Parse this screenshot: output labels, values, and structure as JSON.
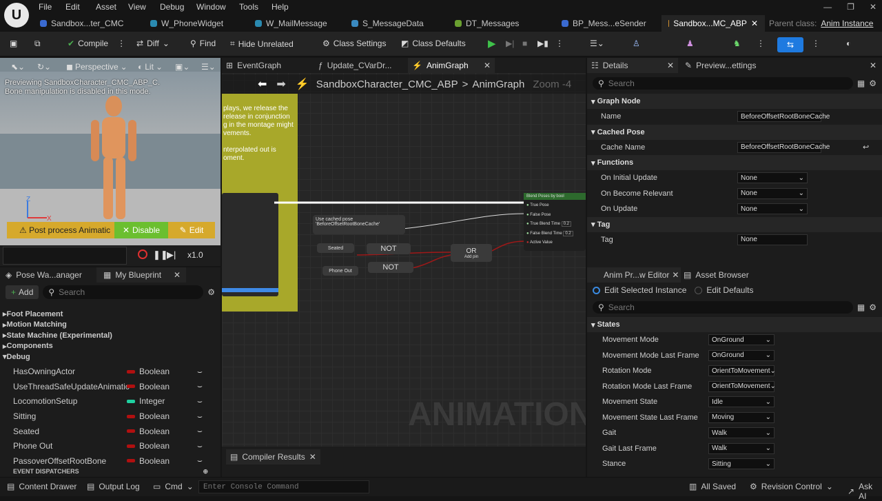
{
  "menu": [
    "File",
    "Edit",
    "Asset",
    "View",
    "Debug",
    "Window",
    "Tools",
    "Help"
  ],
  "tabs": [
    "Sandbox...ter_CMC",
    "W_PhoneWidget",
    "W_MailMessage",
    "S_MessageData",
    "DT_Messages",
    "BP_Mess...eSender",
    "Sandbox...MC_ABP"
  ],
  "parent_class_label": "Parent class:",
  "parent_class_value": "Anim Instance",
  "toolbar": {
    "compile": "Compile",
    "diff": "Diff",
    "find": "Find",
    "hide_unrelated": "Hide Unrelated",
    "class_settings": "Class Settings",
    "class_defaults": "Class Defaults"
  },
  "viewport": {
    "perspective": "Perspective",
    "lit": "Lit",
    "preview_text": "Previewing SandboxCharacter_CMC_ABP_C.",
    "disabled_text": "Bone manipulation is disabled in this mode.",
    "warning": "Post process Animatic",
    "disable": "Disable",
    "edit": "Edit",
    "speed": "x1.0",
    "axis_x": "X",
    "axis_z": "Z"
  },
  "graph": {
    "tab_event": "EventGraph",
    "tab_update": "Update_CVarDr...",
    "tab_anim": "AnimGraph",
    "breadcrumb_root": "SandboxCharacter_CMC_ABP",
    "breadcrumb_sep": ">",
    "breadcrumb_leaf": "AnimGraph",
    "zoom": "Zoom -4",
    "comment_lines": [
      "plays, we release the",
      "release in conjunction",
      "g in the montage might",
      "vements.",
      "",
      "nterpolated out is",
      "oment."
    ],
    "watermark": "ANIMATION",
    "blend_title": "Blend Poses by bool",
    "blend_pins": [
      "True Pose",
      "False Pose",
      "True Blend Time",
      "False Blend Time",
      "Active Value"
    ],
    "blend_val": "0.2",
    "cached_pose": "Use cached pose 'BeforeOffsetRootBoneCache'",
    "seated": "Seated",
    "phone_out": "Phone Out",
    "not": "NOT",
    "or": "OR",
    "add_pin": "Add pin",
    "compiler_results": "Compiler Results"
  },
  "left": {
    "tab_pose": "Pose Wa...anager",
    "tab_bp": "My Blueprint",
    "add": "Add",
    "search": "Search",
    "categories": [
      "Foot Placement",
      "Motion Matching",
      "State Machine (Experimental)",
      "Components",
      "Debug"
    ],
    "variables": [
      {
        "name": "HasOwningActor",
        "type": "Boolean",
        "color": "#b01010"
      },
      {
        "name": "UseThreadSafeUpdateAnimatic",
        "type": "Boolean",
        "color": "#b01010"
      },
      {
        "name": "LocomotionSetup",
        "type": "Integer",
        "color": "#1fd0a0"
      },
      {
        "name": "Sitting",
        "type": "Boolean",
        "color": "#b01010"
      },
      {
        "name": "Seated",
        "type": "Boolean",
        "color": "#b01010"
      },
      {
        "name": "Phone Out",
        "type": "Boolean",
        "color": "#b01010"
      },
      {
        "name": "PassoverOffsetRootBone",
        "type": "Boolean",
        "color": "#b01010"
      }
    ],
    "event_dispatchers": "EVENT DISPATCHERS"
  },
  "details": {
    "tab": "Details",
    "tab2": "Preview...ettings",
    "search": "Search",
    "sections": [
      {
        "title": "Graph Node",
        "props": [
          {
            "name": "Name",
            "value": "BeforeOffsetRootBoneCache"
          }
        ]
      },
      {
        "title": "Cached Pose",
        "props": [
          {
            "name": "Cache Name",
            "value": "BeforeOffsetRootBoneCache"
          }
        ]
      },
      {
        "title": "Functions",
        "props": [
          {
            "name": "On Initial Update",
            "value": "None"
          },
          {
            "name": "On Become Relevant",
            "value": "None"
          },
          {
            "name": "On Update",
            "value": "None"
          }
        ]
      },
      {
        "title": "Tag",
        "props": [
          {
            "name": "Tag",
            "value": "None"
          }
        ]
      }
    ]
  },
  "anim_editor": {
    "tab": "Anim Pr...w Editor",
    "tab2": "Asset Browser",
    "radio1": "Edit Selected Instance",
    "radio2": "Edit Defaults",
    "search": "Search",
    "section": "States",
    "props": [
      {
        "name": "Movement Mode",
        "value": "OnGround"
      },
      {
        "name": "Movement Mode Last Frame",
        "value": "OnGround"
      },
      {
        "name": "Rotation Mode",
        "value": "OrientToMovement"
      },
      {
        "name": "Rotation Mode Last Frame",
        "value": "OrientToMovement"
      },
      {
        "name": "Movement State",
        "value": "Idle"
      },
      {
        "name": "Movement State Last Frame",
        "value": "Moving"
      },
      {
        "name": "Gait",
        "value": "Walk"
      },
      {
        "name": "Gait Last Frame",
        "value": "Walk"
      },
      {
        "name": "Stance",
        "value": "Sitting"
      }
    ]
  },
  "status": {
    "content_drawer": "Content Drawer",
    "output_log": "Output Log",
    "cmd": "Cmd",
    "console_placeholder": "Enter Console Command",
    "all_saved": "All Saved",
    "revision": "Revision Control",
    "ask_ai": "Ask AI"
  }
}
